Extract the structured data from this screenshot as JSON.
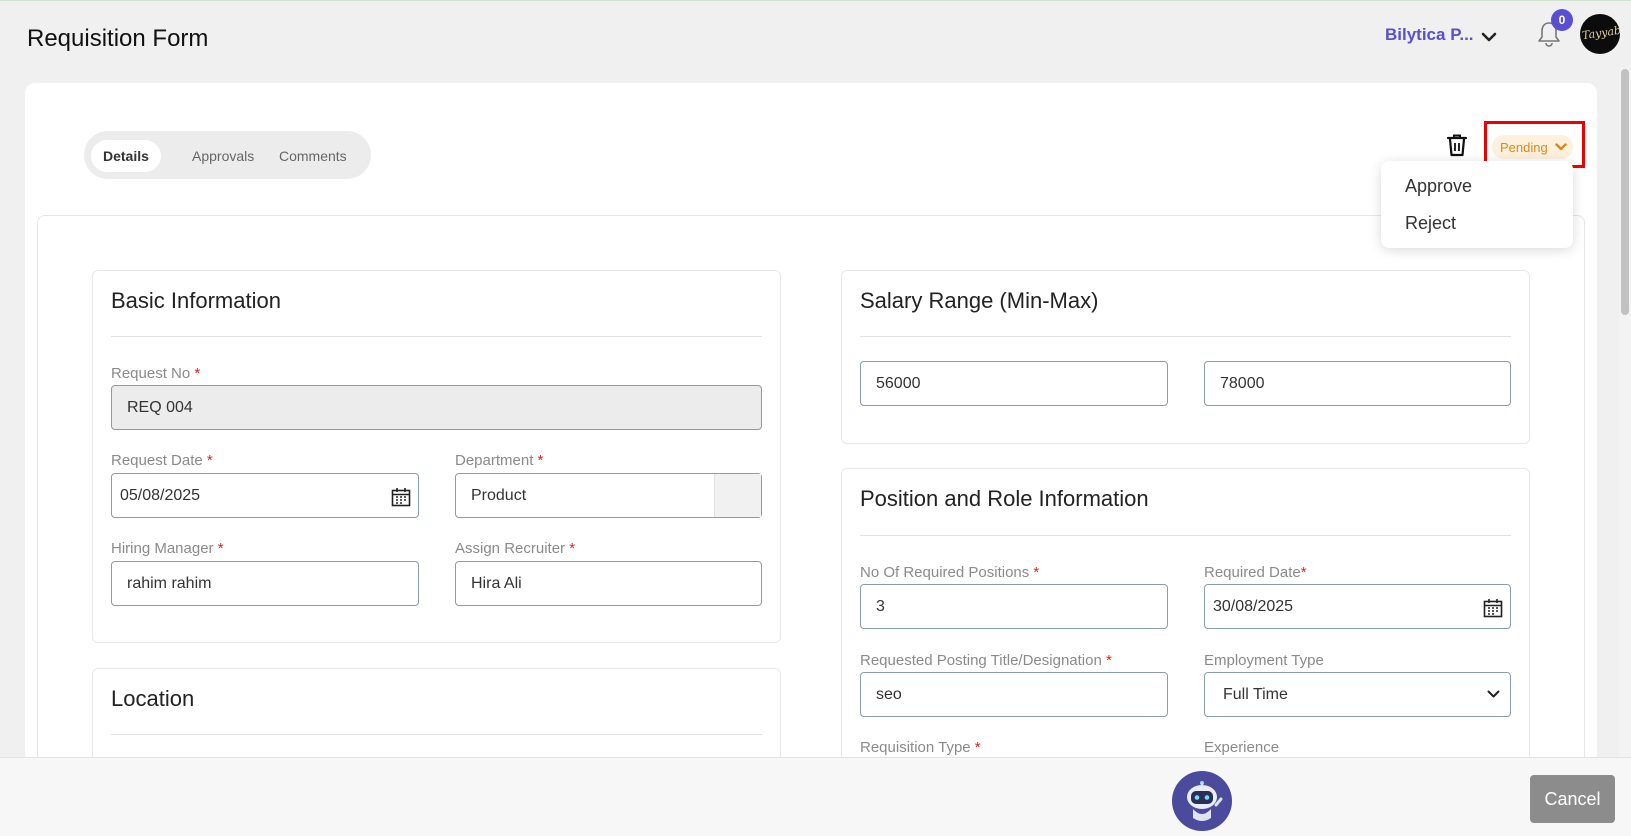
{
  "header": {
    "title": "Requisition Form",
    "company_name": "Bilytica P...",
    "notification_count": "0",
    "avatar_text": "Tayyaba"
  },
  "tabs": [
    {
      "label": "Details",
      "active": true
    },
    {
      "label": "Approvals",
      "active": false
    },
    {
      "label": "Comments",
      "active": false
    }
  ],
  "status": {
    "label": "Pending",
    "menu_items": [
      "Approve",
      "Reject"
    ]
  },
  "basic_info": {
    "title": "Basic Information",
    "request_no_label": "Request No",
    "request_no": "REQ 004",
    "request_date_label": "Request Date",
    "request_date": "05/08/2025",
    "department_label": "Department",
    "department": "Product",
    "hiring_manager_label": "Hiring Manager",
    "hiring_manager": "rahim rahim",
    "assign_recruiter_label": "Assign Recruiter",
    "assign_recruiter": "Hira Ali"
  },
  "location": {
    "title": "Location"
  },
  "salary": {
    "title": "Salary Range (Min-Max)",
    "min": "56000",
    "max": "78000"
  },
  "position": {
    "title": "Position and Role Information",
    "positions_label": "No Of Required Positions",
    "positions": "3",
    "required_date_label": "Required Date",
    "required_date": "30/08/2025",
    "posting_title_label": "Requested Posting Title/Designation",
    "posting_title": "seo",
    "employment_type_label": "Employment Type",
    "employment_type": "Full Time",
    "requisition_type_label": "Requisition Type",
    "experience_label": "Experience"
  },
  "required_marker": "*",
  "footer": {
    "cancel_label": "Cancel"
  },
  "colors": {
    "accent": "#5a4fd0",
    "status_text": "#d98b18",
    "status_bg": "#fdf0dc",
    "highlight_border": "#ee0000",
    "required": "#e02020"
  }
}
